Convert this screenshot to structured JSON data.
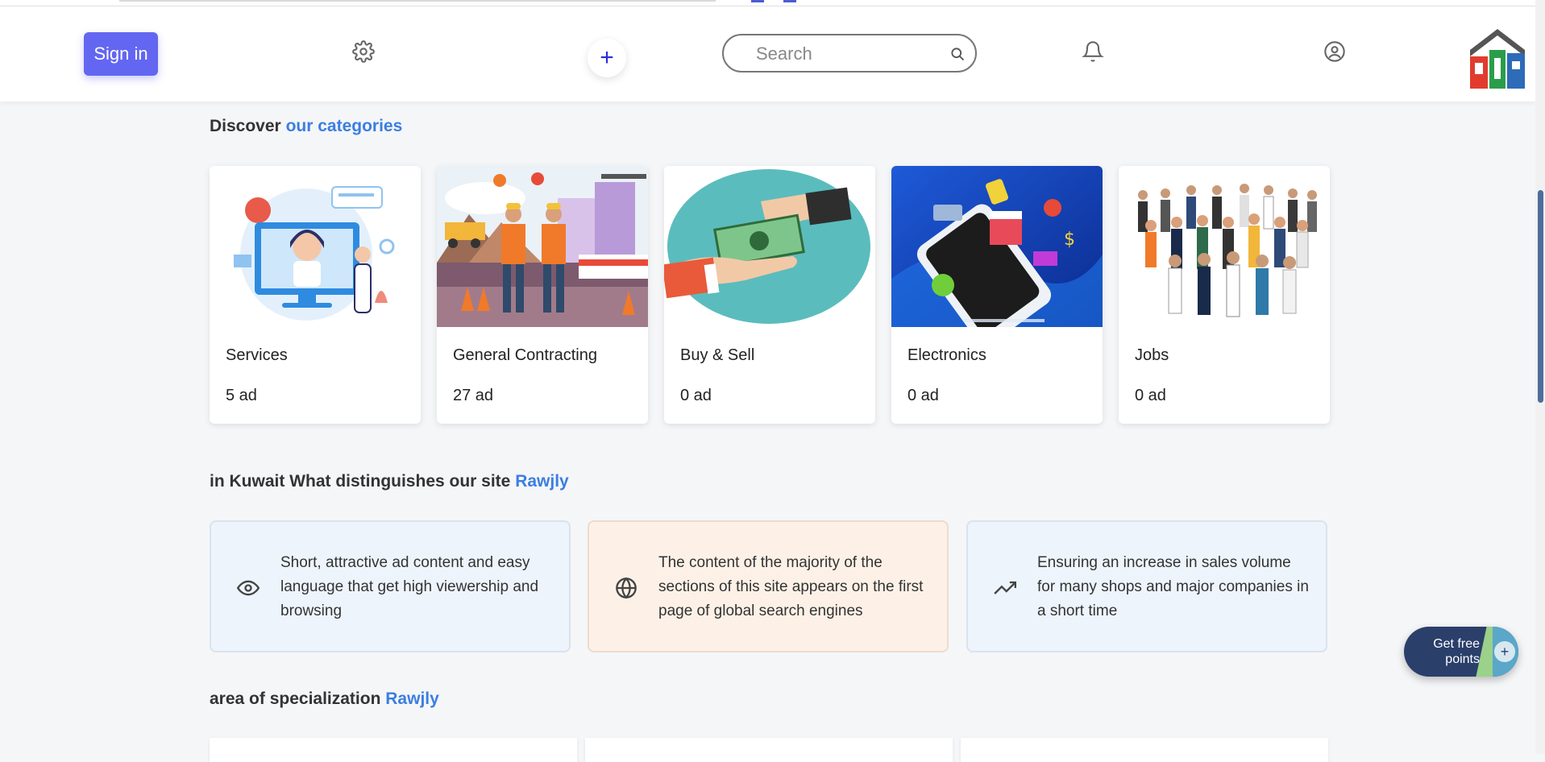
{
  "header": {
    "signin_label": "Sign in",
    "plus_label": "+",
    "search_placeholder": "Search"
  },
  "categories_section": {
    "title_prefix": "Discover",
    "title_accent": "our categories",
    "items": [
      {
        "name": "Services",
        "count": "5 ad"
      },
      {
        "name": "General Contracting",
        "count": "27 ad"
      },
      {
        "name": "Buy & Sell",
        "count": "0 ad"
      },
      {
        "name": "Electronics",
        "count": "0 ad"
      },
      {
        "name": "Jobs",
        "count": "0 ad"
      }
    ]
  },
  "distinguish_section": {
    "title_prefix": "in Kuwait What distinguishes our site",
    "title_accent": "Rawjly",
    "features": [
      {
        "icon": "eye-icon",
        "text": "Short, attractive ad content and easy language that get high viewership and browsing"
      },
      {
        "icon": "globe-icon",
        "text": "The content of the majority of the sections of this site appears on the first page of global search engines"
      },
      {
        "icon": "trending-up-icon",
        "text": "Ensuring an increase in sales volume for many shops and major companies in a short time"
      }
    ]
  },
  "specialization_section": {
    "title_prefix": "area of specialization",
    "title_accent": "Rawjly"
  },
  "points_button": {
    "label": "Get free points",
    "plus": "+"
  },
  "colors": {
    "accent": "#3b7ee0",
    "signin": "#6366f1",
    "points_bg": "#2b3f6b"
  }
}
